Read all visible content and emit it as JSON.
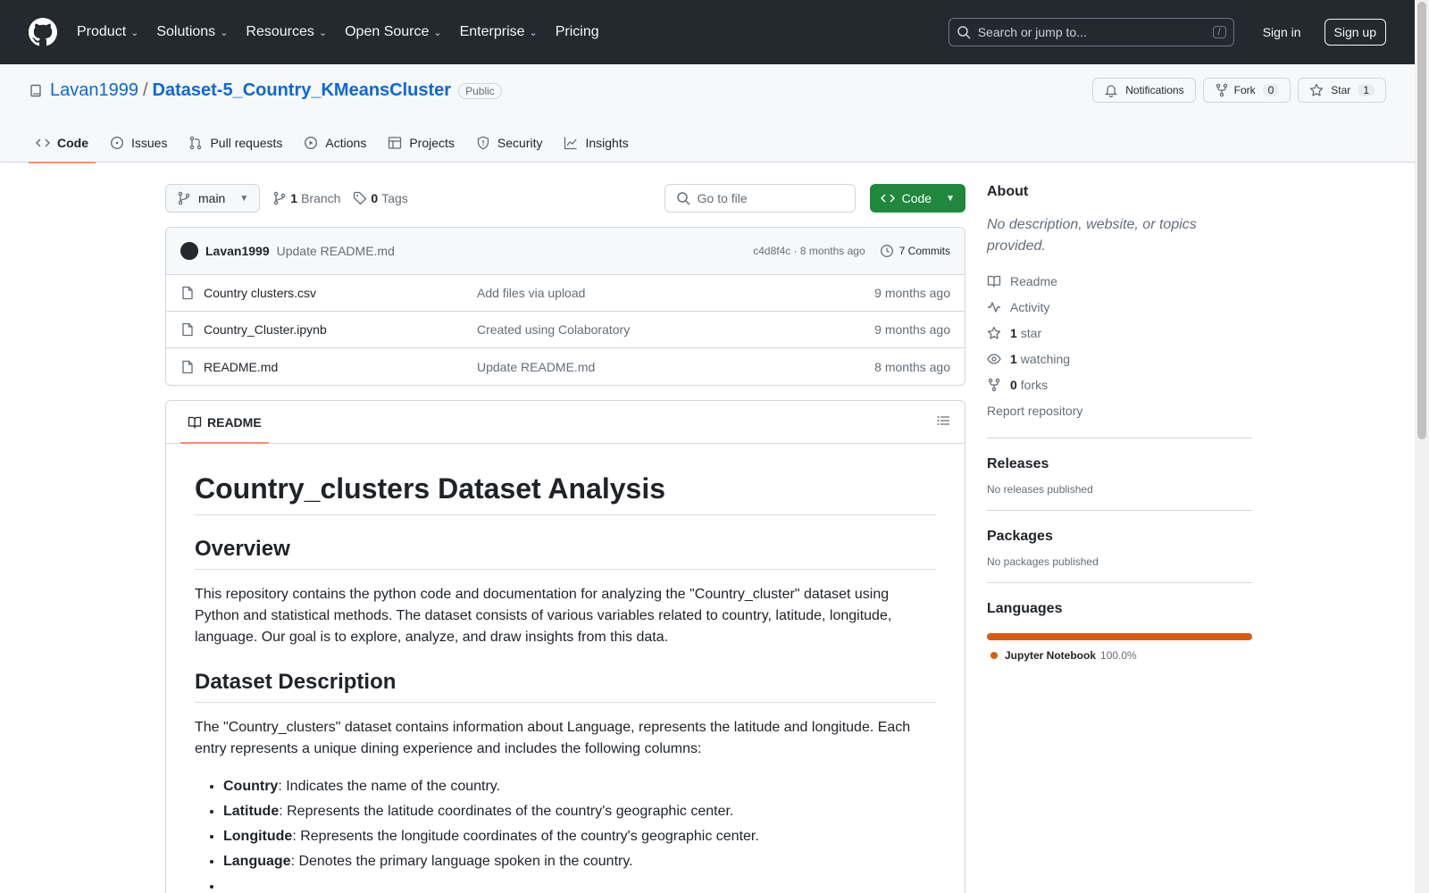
{
  "header": {
    "nav": [
      {
        "label": "Product",
        "dropdown": true
      },
      {
        "label": "Solutions",
        "dropdown": true
      },
      {
        "label": "Resources",
        "dropdown": true
      },
      {
        "label": "Open Source",
        "dropdown": true
      },
      {
        "label": "Enterprise",
        "dropdown": true
      },
      {
        "label": "Pricing",
        "dropdown": false
      }
    ],
    "search_placeholder": "Search or jump to...",
    "search_shortcut": "/",
    "signin": "Sign in",
    "signup": "Sign up"
  },
  "repo": {
    "owner": "Lavan1999",
    "separator": "/",
    "name": "Dataset-5_Country_KMeansCluster",
    "visibility": "Public",
    "notifications_label": "Notifications",
    "fork_label": "Fork",
    "fork_count": "0",
    "star_label": "Star",
    "star_count": "1"
  },
  "tabs": [
    {
      "label": "Code",
      "icon": "code-icon",
      "active": true
    },
    {
      "label": "Issues",
      "icon": "issue-icon"
    },
    {
      "label": "Pull requests",
      "icon": "pull-request-icon"
    },
    {
      "label": "Actions",
      "icon": "play-icon"
    },
    {
      "label": "Projects",
      "icon": "table-icon"
    },
    {
      "label": "Security",
      "icon": "shield-icon"
    },
    {
      "label": "Insights",
      "icon": "graph-icon"
    }
  ],
  "toolbar": {
    "branch": "main",
    "branch_count": "1",
    "branch_label": "Branch",
    "tag_count": "0",
    "tag_label": "Tags",
    "goto_placeholder": "Go to file",
    "code_button": "Code"
  },
  "last_commit": {
    "author": "Lavan1999",
    "message": "Update README.md",
    "sha_time": "c4d8f4c · 8 months ago",
    "commits": "7 Commits"
  },
  "files": [
    {
      "name": "Country clusters.csv",
      "message": "Add files via upload",
      "date": "9 months ago"
    },
    {
      "name": "Country_Cluster.ipynb",
      "message": "Created using Colaboratory",
      "date": "9 months ago"
    },
    {
      "name": "README.md",
      "message": "Update README.md",
      "date": "8 months ago"
    }
  ],
  "readme": {
    "tab_label": "README",
    "h1": "Country_clusters Dataset Analysis",
    "overview_h": "Overview",
    "overview_p": "This repository contains the python code and documentation for analyzing the \"Country_cluster\" dataset using Python and statistical methods. The dataset consists of various variables related to country, latitude, longitude, language. Our goal is to explore, analyze, and draw insights from this data.",
    "desc_h": "Dataset Description",
    "desc_p": "The \"Country_clusters\" dataset contains information about Language, represents the latitude and longitude. Each entry represents a unique dining experience and includes the following columns:",
    "columns": [
      {
        "term": "Country",
        "text": ": Indicates the name of the country."
      },
      {
        "term": "Latitude",
        "text": ": Represents the latitude coordinates of the country's geographic center."
      },
      {
        "term": "Longitude",
        "text": ": Represents the longitude coordinates of the country's geographic center."
      },
      {
        "term": "Language",
        "text": ": Denotes the primary language spoken in the country."
      },
      {
        "term": "",
        "text": ""
      }
    ]
  },
  "about": {
    "title": "About",
    "description": "No description, website, or topics provided.",
    "readme": "Readme",
    "activity": "Activity",
    "stars_count": "1",
    "stars_label": "star",
    "watching_count": "1",
    "watching_label": "watching",
    "forks_count": "0",
    "forks_label": "forks",
    "report": "Report repository"
  },
  "releases": {
    "title": "Releases",
    "text": "No releases published"
  },
  "packages": {
    "title": "Packages",
    "text": "No packages published"
  },
  "languages": {
    "title": "Languages",
    "items": [
      {
        "name": "Jupyter Notebook",
        "percent": "100.0%",
        "color": "#da5b0b"
      }
    ]
  },
  "colors": {
    "header_bg": "#24292f",
    "link": "#0969da",
    "code_btn": "#1f883d",
    "tab_underline": "#fd8c73"
  }
}
